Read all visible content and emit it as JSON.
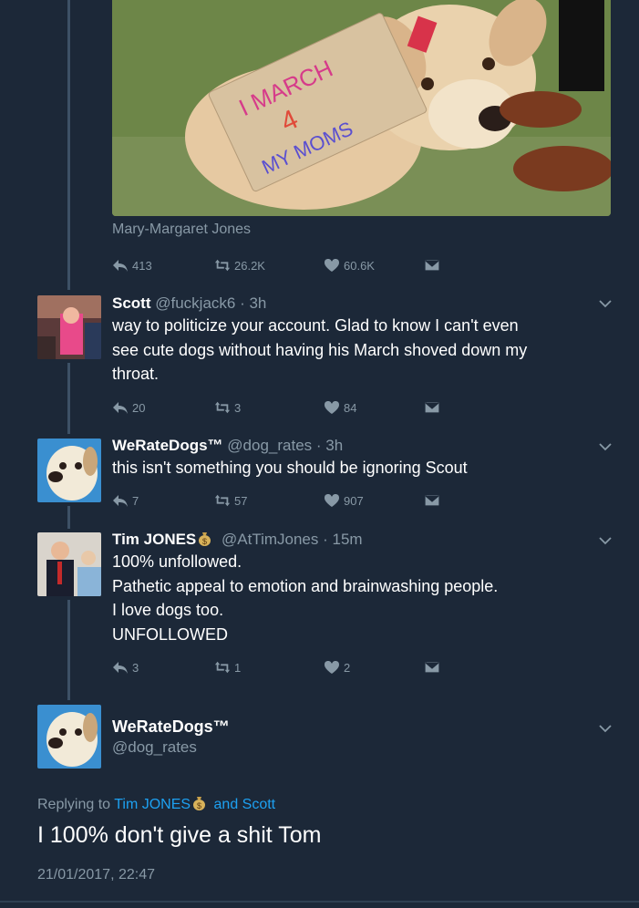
{
  "photo": {
    "sign_text": [
      "I MARCH",
      "4",
      "MY MOMS"
    ],
    "caption": "Mary-Margaret Jones",
    "actions": {
      "reply": "413",
      "retweet": "26.2K",
      "like": "60.6K"
    }
  },
  "tweets": [
    {
      "name": "Scott",
      "handle": "@fuckjack6",
      "time": "· 3h",
      "lines": [
        "way to politicize your account. Glad to know I can't even",
        "see cute dogs without having his March shoved down my",
        "throat."
      ],
      "actions": {
        "reply": "20",
        "retweet": "3",
        "like": "84"
      }
    },
    {
      "name": "WeRateDogs™",
      "handle": "@dog_rates",
      "time": "· 3h",
      "lines": [
        "this isn't something you should be ignoring Scout"
      ],
      "actions": {
        "reply": "7",
        "retweet": "57",
        "like": "907"
      }
    },
    {
      "name": "Tim JONES",
      "handle": "@AtTimJones",
      "time": "· 15m",
      "lines": [
        "100% unfollowed.",
        "Pathetic appeal to emotion and brainwashing people.",
        "I love dogs too.",
        "UNFOLLOWED"
      ],
      "actions": {
        "reply": "3",
        "retweet": "1",
        "like": "2"
      }
    }
  ],
  "main_tweet": {
    "name": "WeRateDogs™",
    "handle": "@dog_rates",
    "replying_prefix": "Replying to",
    "replying_user1": "Tim JONES",
    "replying_and": "and Scott",
    "text": "I 100% don't give a shit Tom",
    "timestamp": "21/01/2017, 22:47"
  },
  "colors": {
    "background": "#1c2838",
    "muted": "#8899a6",
    "link": "#1da1f2",
    "thread": "#3d5166"
  },
  "icons": [
    "reply-icon",
    "retweet-icon",
    "like-icon",
    "dm-icon",
    "chevron-down-icon",
    "money-bag-icon"
  ]
}
